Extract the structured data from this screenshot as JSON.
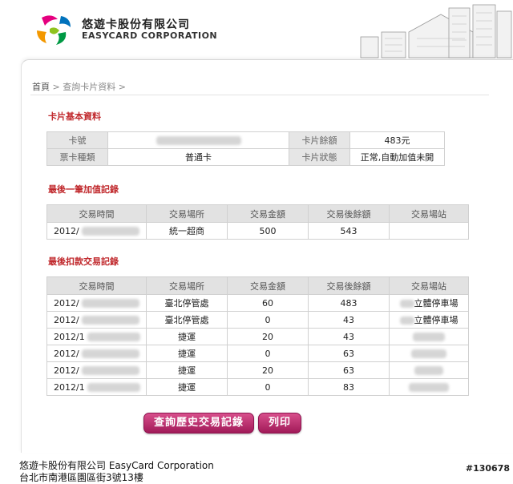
{
  "brand": {
    "name_cn": "悠遊卡股份有限公司",
    "name_en": "EASYCARD CORPORATION"
  },
  "breadcrumb": {
    "home": "首頁",
    "sep1": ">",
    "current": "查詢卡片資料",
    "sep2": ">"
  },
  "basic": {
    "title": "卡片基本資料",
    "card_no_label": "卡號",
    "balance_label": "卡片餘額",
    "balance_value": "483元",
    "type_label": "票卡種類",
    "type_value": "普通卡",
    "status_label": "卡片狀態",
    "status_value": "正常,自動加值未開"
  },
  "topup": {
    "title": "最後一筆加值記錄",
    "headers": [
      "交易時間",
      "交易場所",
      "交易金額",
      "交易後餘額",
      "交易場站"
    ],
    "rows": [
      {
        "date": "2012/",
        "place": "統一超商",
        "amount": "500",
        "balance": "543",
        "station": ""
      }
    ]
  },
  "deduct": {
    "title": "最後扣款交易記錄",
    "headers": [
      "交易時間",
      "交易場所",
      "交易金額",
      "交易後餘額",
      "交易場站"
    ],
    "rows": [
      {
        "date": "2012/",
        "place": "臺北停管處",
        "amount": "60",
        "balance": "483",
        "station": "立體停車場"
      },
      {
        "date": "2012/",
        "place": "臺北停管處",
        "amount": "0",
        "balance": "43",
        "station": "立體停車場"
      },
      {
        "date": "2012/1",
        "place": "捷運",
        "amount": "20",
        "balance": "43",
        "station": ""
      },
      {
        "date": "2012/",
        "place": "捷運",
        "amount": "0",
        "balance": "63",
        "station": ""
      },
      {
        "date": "2012/",
        "place": "捷運",
        "amount": "20",
        "balance": "63",
        "station": ""
      },
      {
        "date": "2012/1",
        "place": "捷運",
        "amount": "0",
        "balance": "83",
        "station": ""
      }
    ]
  },
  "buttons": {
    "history": "查詢歷史交易記錄",
    "print": "列印"
  },
  "footer": {
    "company": "悠遊卡股份有限公司 EasyCard Corporation",
    "address": "台北市南港區園區街3號13樓"
  },
  "watermark": "#130678",
  "colors": {
    "section_title": "#c0282c",
    "button": "#b8246a"
  }
}
